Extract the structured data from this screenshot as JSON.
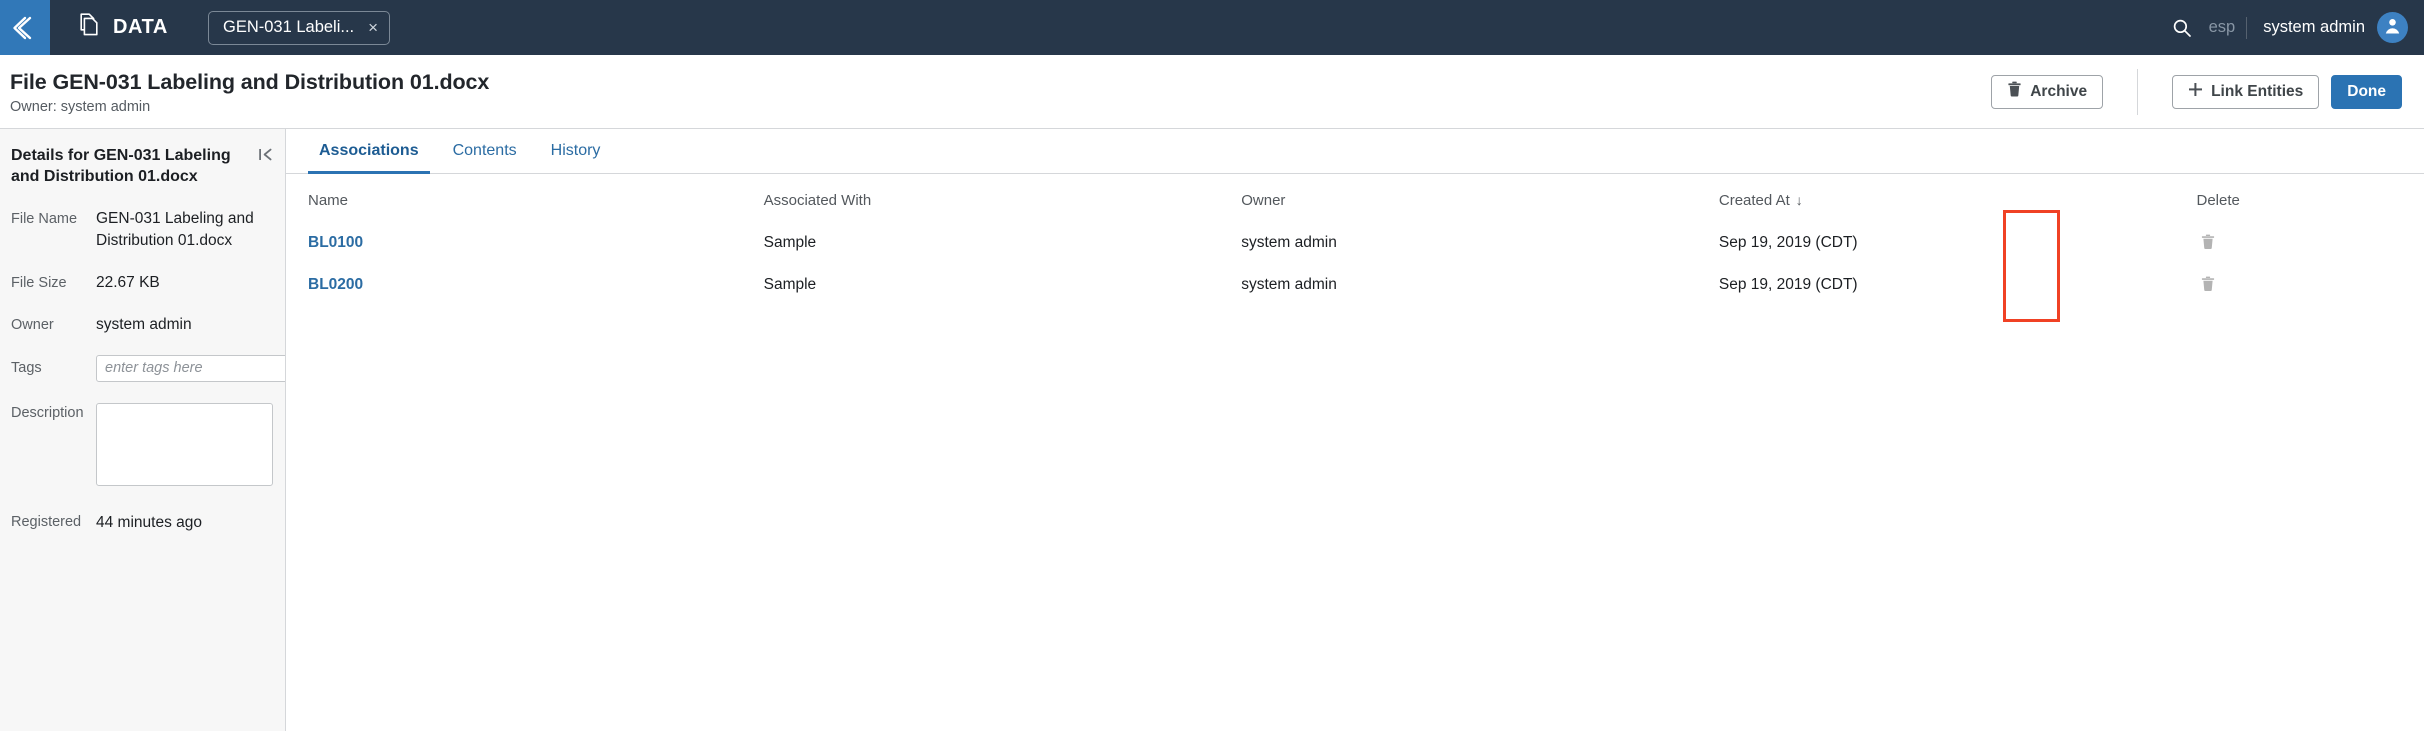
{
  "topbar": {
    "back_icon": "chevron-left-icon",
    "brand_icon": "documents-icon",
    "brand_label": "DATA",
    "open_tab": {
      "label": "GEN-031 Labeli...",
      "close": "×"
    },
    "search_icon": "search-icon",
    "locale_label": "esp",
    "user_name": "system admin",
    "avatar_icon": "user-avatar-icon"
  },
  "titlebar": {
    "title": "File GEN-031 Labeling and Distribution 01.docx",
    "subtitle": "Owner: system admin",
    "archive_label": "Archive",
    "archive_icon": "trash-icon",
    "link_entities_label": "Link Entities",
    "link_entities_icon": "plus-icon",
    "done_label": "Done"
  },
  "details": {
    "panel_title": "Details for GEN-031 Labeling and Distribution 01.docx",
    "collapse_icon": "collapse-panel-icon",
    "fields": {
      "file_name_label": "File Name",
      "file_name_value": "GEN-031 Labeling and Distribution 01.docx",
      "file_size_label": "File Size",
      "file_size_value": "22.67 KB",
      "owner_label": "Owner",
      "owner_value": "system admin",
      "tags_label": "Tags",
      "tags_value": "",
      "tags_placeholder": "enter tags here",
      "description_label": "Description",
      "description_value": "",
      "registered_label": "Registered",
      "registered_value": "44 minutes ago"
    }
  },
  "tabs": [
    {
      "label": "Associations",
      "active": true
    },
    {
      "label": "Contents",
      "active": false
    },
    {
      "label": "History",
      "active": false
    }
  ],
  "table": {
    "columns": [
      "Name",
      "Associated With",
      "Owner",
      "Created At",
      "Delete"
    ],
    "sort_column": "Created At",
    "sort_arrow": "↓",
    "rows": [
      {
        "name": "BL0100",
        "associated_with": "Sample",
        "owner": "system admin",
        "created_at": "Sep 19, 2019 (CDT)",
        "delete_icon": "trash-icon"
      },
      {
        "name": "BL0200",
        "associated_with": "Sample",
        "owner": "system admin",
        "created_at": "Sep 19, 2019 (CDT)",
        "delete_icon": "trash-icon"
      }
    ]
  },
  "annotation": {
    "highlight_color": "#f04124",
    "highlight_target": "delete-column-trash-icons"
  }
}
